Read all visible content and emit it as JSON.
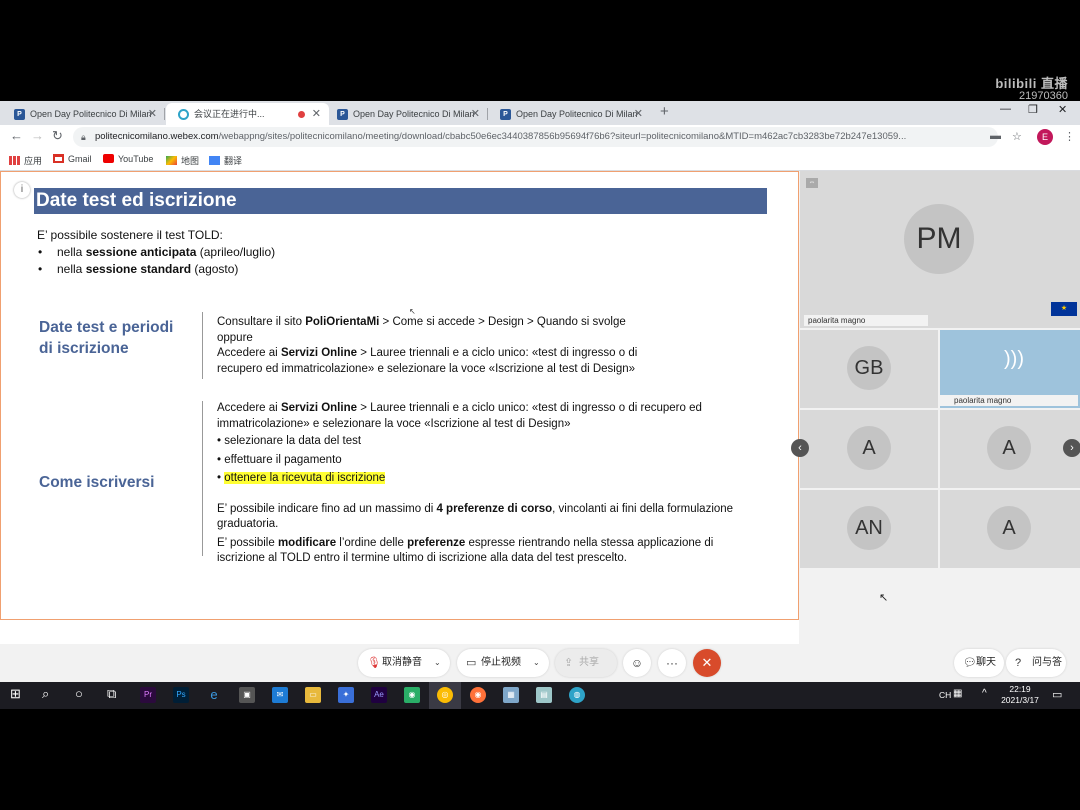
{
  "watermark": {
    "brand": "bilibili 直播",
    "room_id": "21970360"
  },
  "browser": {
    "tabs": [
      {
        "title": "Open Day Politecnico Di Milan",
        "favicon": "webex-doc-icon"
      },
      {
        "title": "会议正在进行中...",
        "favicon": "webex-logo-icon"
      },
      {
        "title": "Open Day Politecnico Di Milan",
        "favicon": "webex-doc-icon"
      },
      {
        "title": "Open Day Politecnico Di Milan",
        "favicon": "webex-doc-icon"
      }
    ],
    "url_host": "politecnicomilano.webex.com",
    "url_path": "/webappng/sites/politecnicomilano/meeting/download/cbabc50e6ec3440387856b95694f76b6?siteurl=politecnicomilano&MTID=m462ac7cb3283be72b247e13059...",
    "profile_initial": "E",
    "bookmarks": [
      "应用",
      "Gmail",
      "YouTube",
      "地图",
      "翻译"
    ]
  },
  "slide": {
    "title": "Date test ed iscrizione",
    "intro": "E’ possibile sostenere il test TOLD:",
    "bullets": [
      {
        "pre": "nella ",
        "bold": "sessione anticipata",
        "post": " (aprileo/luglio)"
      },
      {
        "pre": "nella ",
        "bold": "sessione standard",
        "post": " (agosto)"
      }
    ],
    "section1": {
      "heading_line1": "Date test e periodi",
      "heading_line2": "di iscrizione",
      "l1_pre": "Consultare il sito ",
      "l1_bold": "PoliOrientaMi",
      "l1_post": " > Come si accede > Design > Quando si svolge",
      "l2": "oppure",
      "l3_pre": "Accedere ai ",
      "l3_bold": "Servizi Online",
      "l3_post": " > Lauree triennali e a ciclo unico: «test di ingresso o di",
      "l4": "recupero ed immatricolazione» e selezionare la voce «Iscrizione al test di Design»"
    },
    "section2": {
      "heading": "Come iscriversi",
      "p1_pre": "Accedere ai ",
      "p1_bold": "Servizi Online",
      "p1_post": " > Lauree triennali e a ciclo unico: «test di ingresso o di recupero ed",
      "p1_l2": "immatricolazione» e selezionare la voce «Iscrizione al test di Design»",
      "steps": [
        "selezionare la data del test",
        "effettuare il pagamento",
        "ottenere la ricevuta di iscrizione"
      ],
      "p2_pre": "E’ possibile indicare fino ad un massimo di ",
      "p2_bold": "4 preferenze di corso",
      "p2_post": ", vincolanti ai fini della formulazione",
      "p2_l2": "graduatoria.",
      "p3_pre": "E’ possibile ",
      "p3_bold1": "modificare",
      "p3_mid": " l’ordine delle ",
      "p3_bold2": "preferenze",
      "p3_post": " espresse rientrando nella stessa applicazione di",
      "p3_l2": "iscrizione al TOLD entro il termine ultimo di iscrizione alla data del test prescelto."
    }
  },
  "participants": {
    "main": {
      "initials": "PM",
      "name": "paolarita magno"
    },
    "tiles": [
      {
        "initials": "GB"
      },
      {
        "initials": "",
        "name": "paolarita magno"
      },
      {
        "initials": "A"
      },
      {
        "initials": "A"
      },
      {
        "initials": "AN"
      },
      {
        "initials": "A"
      }
    ]
  },
  "controls": {
    "unmute": "取消静音",
    "stop_video": "停止视频",
    "share": "共享",
    "chat": "聊天",
    "qa": "问与答"
  },
  "taskbar": {
    "ime": "CH",
    "time": "22:19",
    "date": "2021/3/17"
  },
  "colors": {
    "slide_title_bg": "#4a6496",
    "heading": "#4a6496",
    "highlight": "#ffff33",
    "end_call": "#d84b2b"
  }
}
